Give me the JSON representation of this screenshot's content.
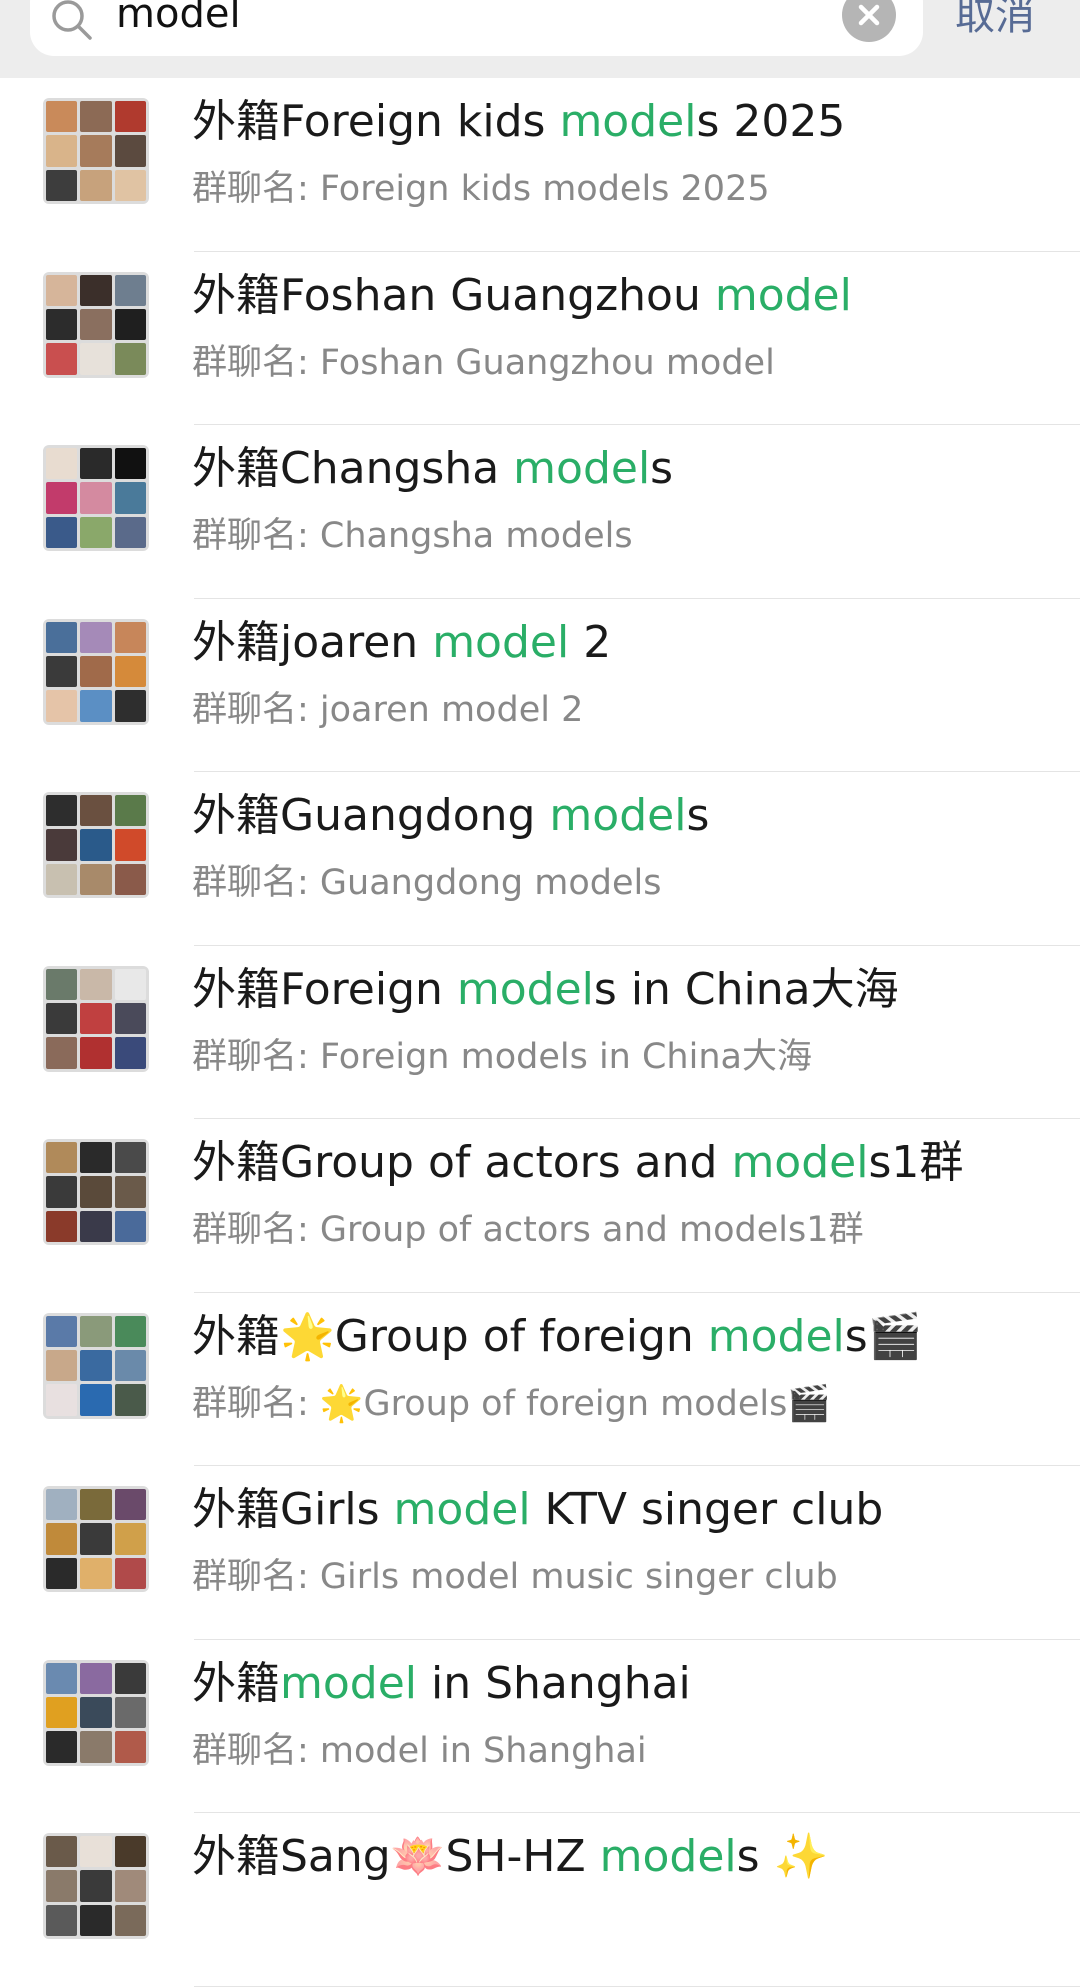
{
  "search": {
    "query": "model",
    "cancel_label": "取消"
  },
  "results": [
    {
      "prefix": "外籍",
      "title_before": "Foreign kids ",
      "title_match": "model",
      "title_after": "s 2025",
      "subtitle": "群聊名: Foreign kids models 2025",
      "avatar_colors": [
        "#c98a5a",
        "#8c6a55",
        "#b03a2e",
        "#d9b48a",
        "#a67b5b",
        "#5b4a3f",
        "#3d3d3d",
        "#c7a27c",
        "#e0c3a3"
      ]
    },
    {
      "prefix": "外籍",
      "title_before": "Foshan Guangzhou ",
      "title_match": "model",
      "title_after": "",
      "subtitle": "群聊名: Foshan Guangzhou model",
      "avatar_colors": [
        "#d6b59a",
        "#3b2f2a",
        "#6e7e8f",
        "#2c2c2c",
        "#8a6f5f",
        "#1f1f1f",
        "#c94f4f",
        "#e7e1da",
        "#7a8a5a"
      ]
    },
    {
      "prefix": "外籍",
      "title_before": "Changsha ",
      "title_match": "model",
      "title_after": "s",
      "subtitle": "群聊名: Changsha models",
      "avatar_colors": [
        "#e8dcd0",
        "#2a2a2a",
        "#111111",
        "#c23b6b",
        "#d48aa0",
        "#4a7a9a",
        "#3a5a8a",
        "#8aa86a",
        "#5a6a8a"
      ]
    },
    {
      "prefix": "外籍",
      "title_before": "joaren ",
      "title_match": "model",
      "title_after": " 2",
      "subtitle": "群聊名: joaren model 2",
      "avatar_colors": [
        "#4a6f9a",
        "#a58ab8",
        "#c7865a",
        "#3a3a3a",
        "#a06a4a",
        "#d58a3a",
        "#e5c4a8",
        "#5b8fc4",
        "#2e2e2e"
      ]
    },
    {
      "prefix": "外籍",
      "title_before": "Guangdong ",
      "title_match": "model",
      "title_after": "s",
      "subtitle": "群聊名: Guangdong models",
      "avatar_colors": [
        "#2d2d2d",
        "#6a5040",
        "#5a7a4a",
        "#4a3a3a",
        "#2a5a8a",
        "#d04a2a",
        "#c8c0b0",
        "#a88a6a",
        "#8a5a4a"
      ]
    },
    {
      "prefix": "外籍",
      "title_before": "Foreign ",
      "title_match": "model",
      "title_after": "s in China大海",
      "subtitle": "群聊名: Foreign models in China大海",
      "avatar_colors": [
        "#6a7a6a",
        "#c9b8a8",
        "#e8e8e8",
        "#3a3a3a",
        "#c04040",
        "#4a4a5a",
        "#8a6a5a",
        "#b03030",
        "#3a4a7a"
      ]
    },
    {
      "prefix": "外籍",
      "title_before": "Group of actors and ",
      "title_match": "model",
      "title_after": "s1群",
      "subtitle": "群聊名: Group of actors and models1群",
      "avatar_colors": [
        "#b08a5a",
        "#2a2a2a",
        "#4a4a4a",
        "#3a3a3a",
        "#5a4a3a",
        "#6a5a4a",
        "#8a3a2a",
        "#3a3a4a",
        "#4a6a9a"
      ]
    },
    {
      "prefix": "外籍",
      "title_before": "🌟Group of foreign ",
      "title_match": "model",
      "title_after": "s🎬",
      "subtitle": "群聊名: 🌟Group of foreign models🎬",
      "avatar_colors": [
        "#5a7aa8",
        "#8a9a7a",
        "#4a8a5a",
        "#c8a88a",
        "#3a6aa0",
        "#6a8aaa",
        "#e8e0e0",
        "#2a6ab0",
        "#4a5a4a"
      ]
    },
    {
      "prefix": "外籍",
      "title_before": "Girls ",
      "title_match": "model",
      "title_after": " KTV singer club",
      "subtitle": "群聊名: Girls model music singer club",
      "avatar_colors": [
        "#a0b0c0",
        "#7a6a3a",
        "#6a4a6a",
        "#c08a3a",
        "#3a3a3a",
        "#d0a04a",
        "#2a2a2a",
        "#e0b06a",
        "#b04a4a"
      ]
    },
    {
      "prefix": "外籍",
      "title_before": "",
      "title_match": "model",
      "title_after": " in Shanghai",
      "subtitle": "群聊名: model in Shanghai",
      "avatar_colors": [
        "#6a8ab0",
        "#8a6aa0",
        "#3a3a3a",
        "#e0a020",
        "#3a4a5a",
        "#6a6a6a",
        "#2a2a2a",
        "#8a7a6a",
        "#b05a4a"
      ]
    },
    {
      "prefix": "外籍",
      "title_before": "Sang🪷SH-HZ ",
      "title_match": "model",
      "title_after": "s ✨",
      "subtitle": "",
      "avatar_colors": [
        "#6a5a4a",
        "#e8e0d8",
        "#4a3a2a",
        "#8a7a6a",
        "#3a3a3a",
        "#a08a7a",
        "#5a5a5a",
        "#2a2a2a",
        "#7a6a5a"
      ]
    }
  ]
}
